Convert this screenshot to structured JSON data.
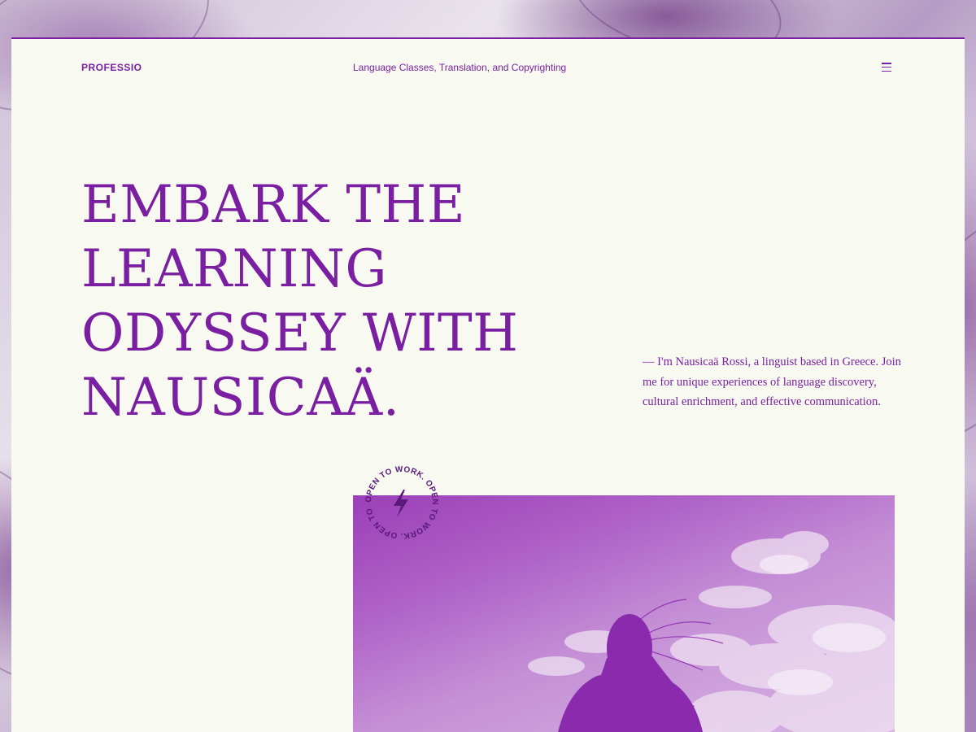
{
  "header": {
    "logo": "PROFESSIO",
    "tagline": "Language Classes, Translation, and Copyrighting",
    "menu_icon": "hamburger-menu-icon"
  },
  "hero": {
    "headline": "EMBARK THE LEARNING ODYSSEY WITH NAUSICAÄ.",
    "intro": "— I'm Nausicaä Rossi, a linguist based in Greece. Join me for unique experiences of language discovery, cultural enrichment, and effective communication."
  },
  "badge": {
    "text": "OPEN TO WORK. OPEN TO WORK. OPEN TO WORK.",
    "icon": "lightning-bolt-icon"
  },
  "colors": {
    "accent": "#7a1fa2",
    "card_background": "#f8faf2"
  }
}
